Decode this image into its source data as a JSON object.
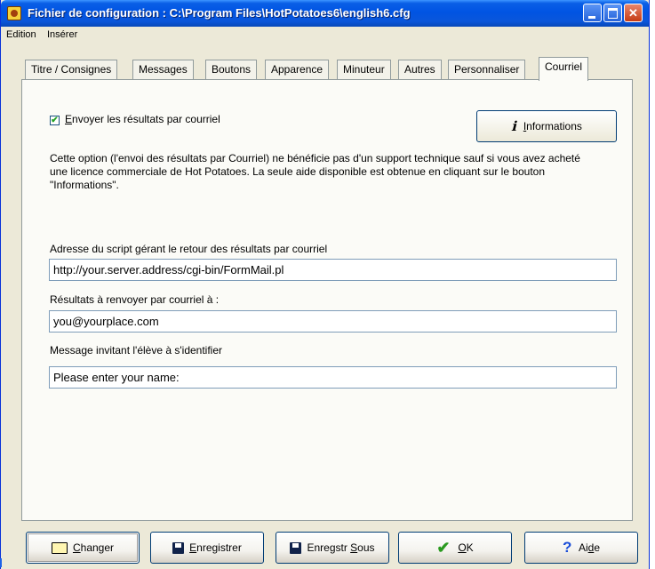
{
  "window": {
    "title": "Fichier de configuration : C:\\Program Files\\HotPotatoes6\\english6.cfg",
    "icon": "hot-potatoes-icon"
  },
  "menu": {
    "edition": "Edition",
    "inserer": "Insérer"
  },
  "tabs": [
    {
      "label": "Titre / Consignes",
      "active": false
    },
    {
      "label": "Messages",
      "active": false
    },
    {
      "label": "Boutons",
      "active": false
    },
    {
      "label": "Apparence",
      "active": false
    },
    {
      "label": "Minuteur",
      "active": false
    },
    {
      "label": "Autres",
      "active": false
    },
    {
      "label": "Personnaliser",
      "active": false
    },
    {
      "label": "Courriel",
      "active": true
    }
  ],
  "courriel": {
    "send_checkbox": {
      "label_underlined": "E",
      "label_rest": "nvoyer les résultats par courriel",
      "checked": true
    },
    "info_button": {
      "label_underlined": "I",
      "label_rest": "nformations",
      "icon": "info-icon"
    },
    "notice": "Cette option (l'envoi des résultats par Courriel) ne bénéficie pas d'un support technique sauf si vous avez acheté une licence commerciale de Hot Potatoes. La seule aide disponible est obtenue en cliquant sur le bouton \"Informations\".",
    "script_label": "Adresse du script gérant le retour des résultats par courriel",
    "script_value": "http://your.server.address/cgi-bin/FormMail.pl",
    "recipient_label": "Résultats à renvoyer par courriel à :",
    "recipient_value": "you@yourplace.com",
    "ident_label": "Message invitant l'élève à s'identifier",
    "ident_value": "Please enter your name:"
  },
  "buttons": {
    "changer": {
      "u": "C",
      "rest": "hanger",
      "icon": "folder-open-icon"
    },
    "enregistrer": {
      "u": "E",
      "rest": "nregistrer",
      "icon": "floppy-disk-icon"
    },
    "enregsous": {
      "pre": "Enregstr ",
      "u": "S",
      "rest": "ous",
      "icon": "floppy-disk-save-as-icon"
    },
    "ok": {
      "u": "O",
      "rest": "K",
      "icon": "checkmark-icon"
    },
    "aide": {
      "pre": "Ai",
      "u": "d",
      "rest": "e",
      "icon": "help-icon"
    }
  }
}
